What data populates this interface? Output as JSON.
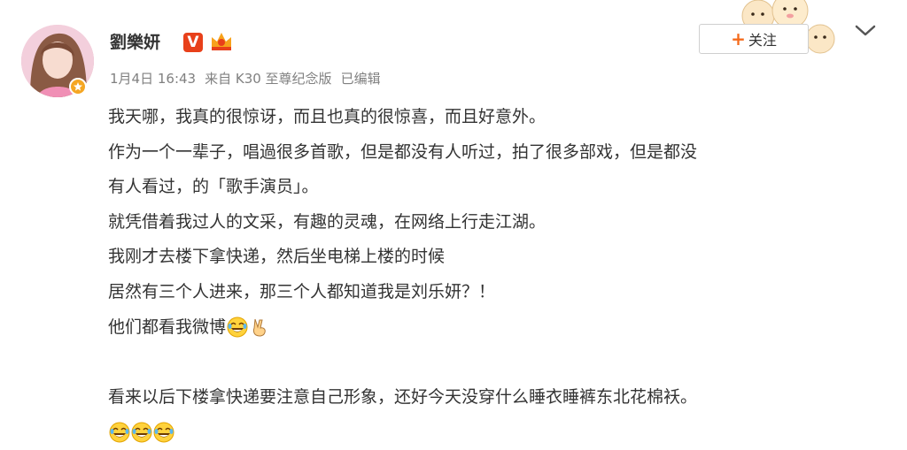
{
  "post": {
    "author": {
      "name": "劉樂妍"
    },
    "meta": {
      "date": "1月4日 16:43",
      "source": "来自 K30 至尊纪念版",
      "edited": "已编辑"
    },
    "follow_label": "关注",
    "lines": [
      "我天哪，我真的很惊讶，而且也真的很惊喜，而且好意外。",
      "作为一个一辈子，唱過很多首歌，但是都没有人听过，拍了很多部戏，但是都没",
      "有人看过，的「歌手演员」。",
      "就凭借着我过人的文采，有趣的灵魂，在网络上行走江湖。",
      "我刚才去楼下拿快递，然后坐电梯上楼的时候",
      "居然有三个人进来，那三个人都知道我是刘乐妍？！",
      "他们都看我微博",
      "看来以后下楼拿快递要注意自己形象，还好今天没穿什么睡衣睡裤东北花棉袄。"
    ],
    "icons": {
      "verified": "V",
      "crown": "crown-icon",
      "laugh": "laugh-cry-emoji",
      "victory": "victory-hand-emoji"
    },
    "colors": {
      "accent": "#f56b1c",
      "verified_bg": "#e8401a",
      "meta_text": "#808080"
    }
  }
}
